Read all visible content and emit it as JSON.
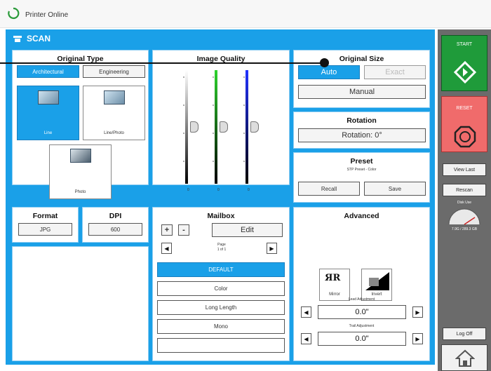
{
  "header": {
    "status": "Printer Online"
  },
  "scan": {
    "title": "SCAN"
  },
  "original_type": {
    "title": "Original Type",
    "tabs": [
      {
        "label": "Architectural",
        "selected": true
      },
      {
        "label": "Engineering",
        "selected": false
      }
    ],
    "options": [
      {
        "label": "Line",
        "selected": true
      },
      {
        "label": "Line/Photo",
        "selected": false
      },
      {
        "label": "Photo",
        "selected": false
      }
    ]
  },
  "image_quality": {
    "title": "Image Quality",
    "slider_ticks": [
      "0",
      "0",
      "0"
    ],
    "slider_levels": [
      0.5,
      0.5,
      0.5
    ]
  },
  "original_size": {
    "title": "Original Size",
    "auto_label": "Auto",
    "exact_label": "Exact",
    "manual_label": "Manual"
  },
  "rotation": {
    "title": "Rotation",
    "value": "Rotation: 0°"
  },
  "preset": {
    "title": "Preset",
    "subtitle": "STP Preset - Color",
    "recall_label": "Recall",
    "save_label": "Save"
  },
  "format": {
    "title": "Format",
    "value": "JPG"
  },
  "dpi": {
    "title": "DPI",
    "value": "600"
  },
  "mailbox": {
    "title": "Mailbox",
    "add_label": "+",
    "remove_label": "-",
    "edit_label": "Edit",
    "page_label": "Page",
    "page_count": "1 of 1",
    "items": [
      {
        "label": "DEFAULT",
        "selected": true
      },
      {
        "label": "Color"
      },
      {
        "label": "Long Length"
      },
      {
        "label": "Mono"
      },
      {
        "label": ""
      }
    ]
  },
  "advanced": {
    "title": "Advanced",
    "mirror_label": "Mirror",
    "invert_label": "Invert",
    "lead_label": "Lead Adjustment",
    "lead_value": "0.0\"",
    "trail_label": "Trail Adjustment",
    "trail_value": "0.0\""
  },
  "sidebar": {
    "start_label": "START",
    "reset_label": "RESET",
    "view_last_label": "View Last",
    "rescan_label": "Rescan",
    "gauge_label": "Disk Use",
    "gauge_value": "7.9G / 289.3 GB",
    "logoff_label": "Log Off"
  },
  "colors": {
    "accent": "#1aa0e8",
    "start": "#1f9b3a",
    "reset": "#f06b6b",
    "sidebar": "#6b6b6b"
  }
}
